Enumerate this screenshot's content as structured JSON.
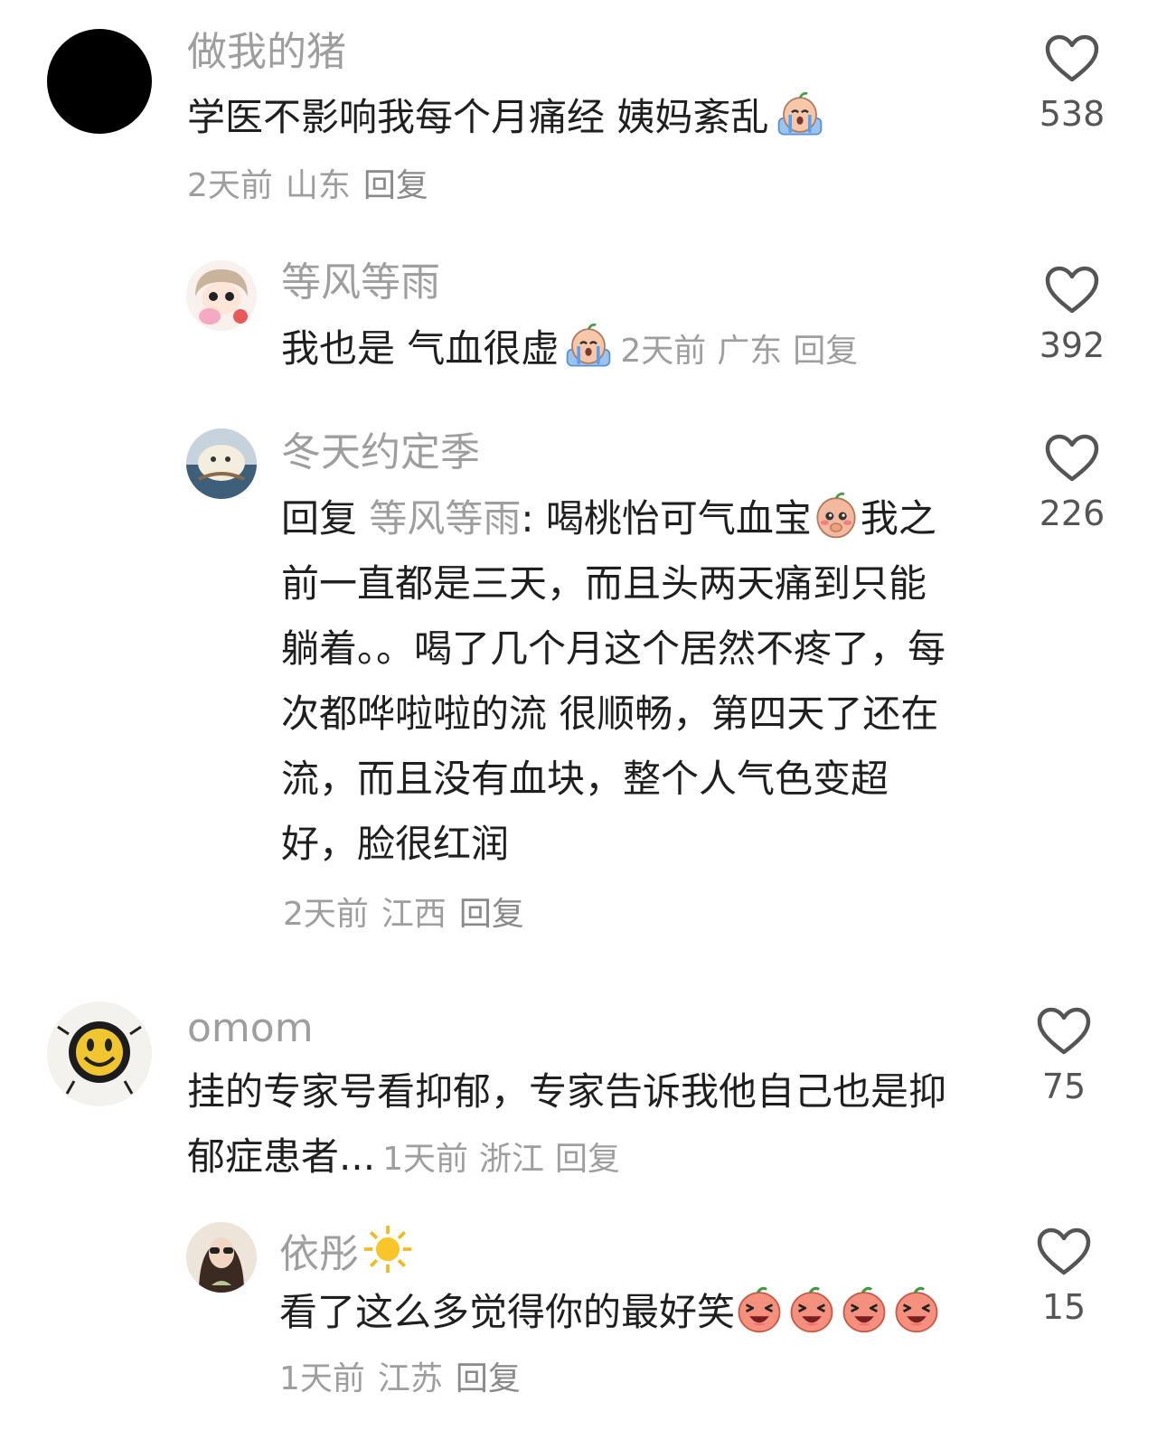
{
  "comments": [
    {
      "user": "做我的猪",
      "text": "学医不影响我每个月痛经 姨妈紊乱",
      "time": "2天前",
      "location": "山东",
      "reply_label": "回复",
      "likes": "538"
    },
    {
      "user": "等风等雨",
      "text": "我也是 气血很虚",
      "time": "2天前",
      "location": "广东",
      "reply_label": "回复",
      "likes": "392"
    },
    {
      "user": "冬天约定季",
      "reply_prefix": "回复",
      "reply_to": "等风等雨",
      "reply_colon": ":",
      "text_a": "喝桃怡可气血宝",
      "text_b": "我之前一直都是三天，而且头两天痛到只能躺着。。喝了几个月这个居然不疼了，每次都哗啦啦的流 很顺畅，第四天了还在流，而且没有血块，整个人气色变超好，脸很红润",
      "time": "2天前",
      "location": "江西",
      "reply_label": "回复",
      "likes": "226"
    },
    {
      "user": "omom",
      "text": "挂的专家号看抑郁，专家告诉我他自己也是抑郁症患者...",
      "time": "1天前",
      "location": "浙江",
      "reply_label": "回复",
      "likes": "75"
    },
    {
      "user": "依彤",
      "text": "看了这么多觉得你的最好笑",
      "time": "1天前",
      "location": "江苏",
      "reply_label": "回复",
      "likes": "15"
    }
  ],
  "icons": {
    "like": "heart-outline-icon",
    "cry": "crying-emoji-icon",
    "laugh": "laughing-emoji-icon",
    "sun": "sun-icon"
  }
}
